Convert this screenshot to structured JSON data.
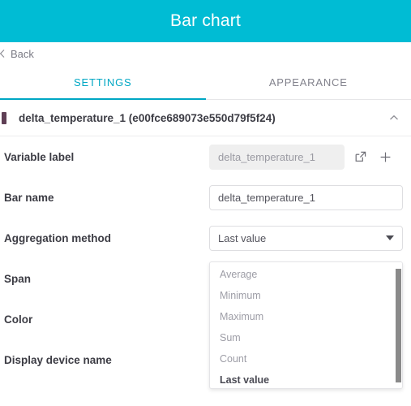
{
  "header": {
    "title": "Bar chart",
    "accent_color": "#00bcd4"
  },
  "back": {
    "label": "Back",
    "icon": "chevron-left-icon"
  },
  "tabs": [
    {
      "label": "SETTINGS",
      "active": true
    },
    {
      "label": "APPEARANCE",
      "active": false
    }
  ],
  "accordion": {
    "title": "delta_temperature_1 (e00fce689073e550d79f5f24)",
    "swatch_color": "#5f3f55",
    "chevron": "chevron-up-icon",
    "expanded": true
  },
  "form": {
    "rows": [
      {
        "label": "Variable label",
        "value": "delta_temperature_1",
        "type": "disabled-text",
        "actions": [
          "open-external-icon",
          "plus-icon"
        ]
      },
      {
        "label": "Bar name",
        "value": "delta_temperature_1",
        "type": "text"
      },
      {
        "label": "Aggregation method",
        "value": "Last value",
        "type": "select"
      },
      {
        "label": "Span",
        "type": "hidden"
      },
      {
        "label": "Color",
        "type": "hidden"
      },
      {
        "label": "Display device name",
        "type": "hidden"
      }
    ]
  },
  "dropdown": {
    "open": true,
    "options": [
      {
        "label": "Average",
        "selected": false
      },
      {
        "label": "Minimum",
        "selected": false
      },
      {
        "label": "Maximum",
        "selected": false
      },
      {
        "label": "Sum",
        "selected": false
      },
      {
        "label": "Count",
        "selected": false
      },
      {
        "label": "Last value",
        "selected": true
      }
    ]
  }
}
